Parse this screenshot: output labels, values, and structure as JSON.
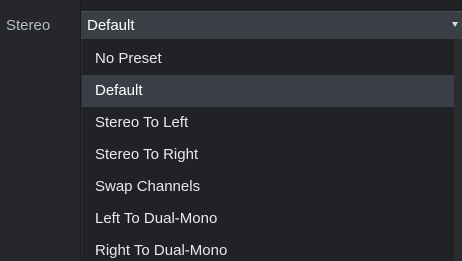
{
  "field": {
    "label": "Stereo",
    "value": "Default"
  },
  "icons": {
    "caret": "chevron-down-icon"
  },
  "options": [
    {
      "label": "No Preset",
      "selected": false
    },
    {
      "label": "Default",
      "selected": true
    },
    {
      "label": "Stereo To Left",
      "selected": false
    },
    {
      "label": "Stereo To Right",
      "selected": false
    },
    {
      "label": "Swap Channels",
      "selected": false
    },
    {
      "label": "Left To Dual-Mono",
      "selected": false
    },
    {
      "label": "Right To Dual-Mono",
      "selected": false
    }
  ],
  "colors": {
    "background": "#1f2124",
    "selected_row": "#3a3f47",
    "select_box": "#3a3e45",
    "label_text": "#b7bcc3",
    "option_text": "#e6e8eb"
  }
}
